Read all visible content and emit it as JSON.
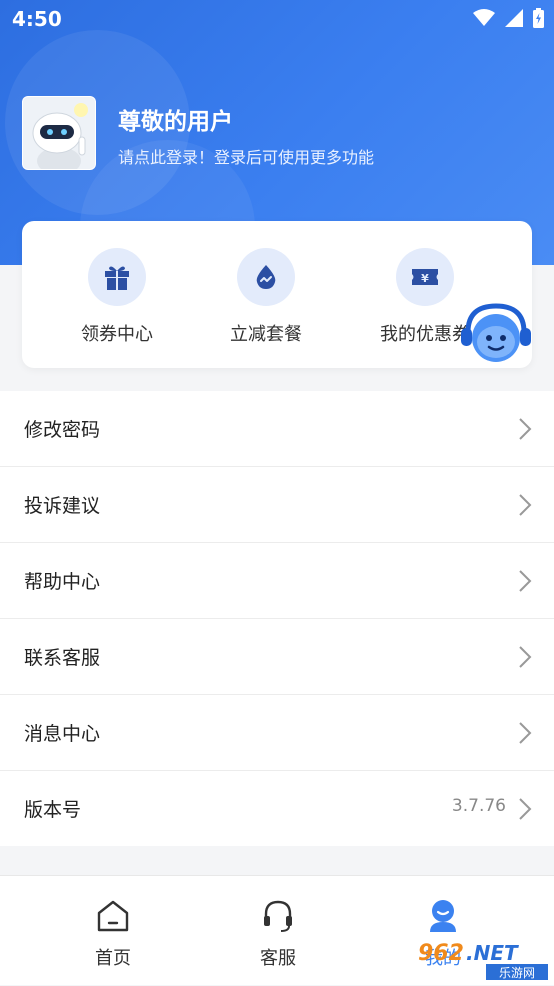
{
  "status_bar": {
    "time": "4:50"
  },
  "profile": {
    "username": "尊敬的用户",
    "login_hint": "请点此登录！登录后可使用更多功能"
  },
  "quick_actions": [
    {
      "label": "领券中心",
      "icon": "gift-icon"
    },
    {
      "label": "立减套餐",
      "icon": "drop-icon"
    },
    {
      "label": "我的优惠券",
      "icon": "ticket-yen-icon"
    }
  ],
  "menu": {
    "items": [
      {
        "label": "修改密码"
      },
      {
        "label": "投诉建议"
      },
      {
        "label": "帮助中心"
      },
      {
        "label": "联系客服"
      },
      {
        "label": "消息中心"
      },
      {
        "label": "版本号",
        "value": "3.7.76"
      }
    ]
  },
  "tabbar": {
    "tabs": [
      {
        "label": "首页",
        "icon": "home-icon"
      },
      {
        "label": "客服",
        "icon": "headset-icon"
      },
      {
        "label": "我的",
        "icon": "user-icon"
      }
    ]
  },
  "watermark": {
    "text": "962.NET",
    "subtext": "乐游网"
  },
  "colors": {
    "primary": "#2d6ee0",
    "icon_bg": "#e3ebfb",
    "icon_fg": "#2c4fa3",
    "text": "#222222",
    "muted": "#888888"
  }
}
